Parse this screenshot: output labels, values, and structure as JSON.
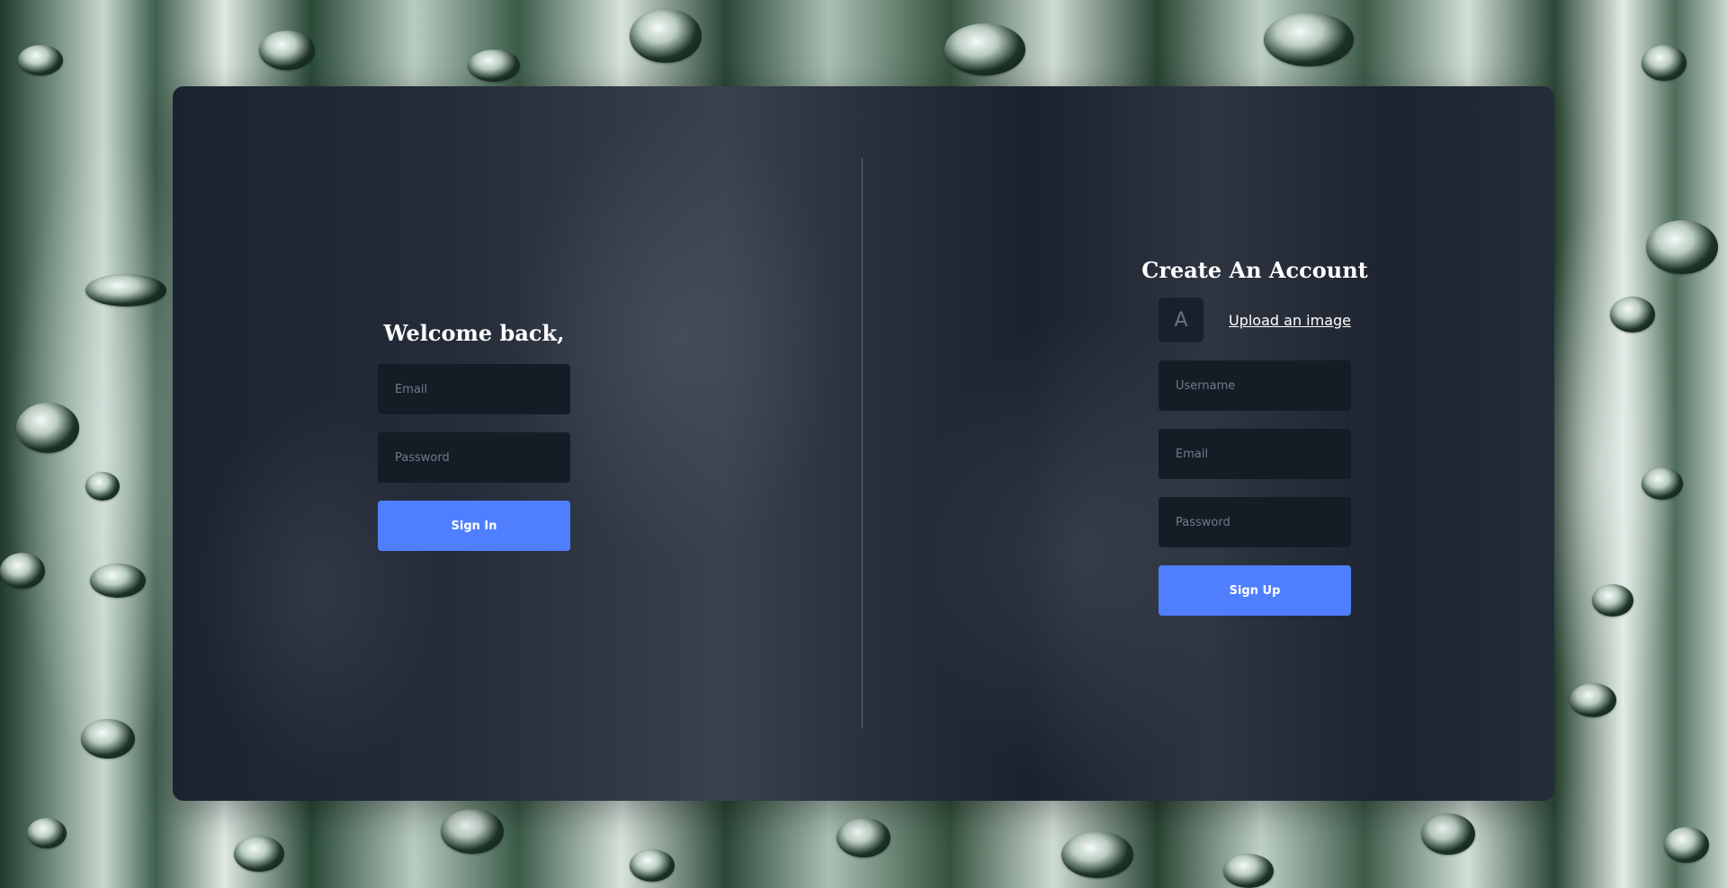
{
  "login": {
    "title": "Welcome back,",
    "email_placeholder": "Email",
    "password_placeholder": "Password",
    "submit_label": "Sign In"
  },
  "signup": {
    "title": "Create An Account",
    "avatar_letter": "A",
    "upload_label": "Upload an image",
    "username_placeholder": "Username",
    "email_placeholder": "Email",
    "password_placeholder": "Password",
    "submit_label": "Sign Up"
  },
  "colors": {
    "card_background": "#252c39",
    "field_background": "#161c26",
    "button_accent": "#4f7fff",
    "text": "#ffffff"
  },
  "icons": {
    "background": "raindrops-on-glass-photo"
  }
}
